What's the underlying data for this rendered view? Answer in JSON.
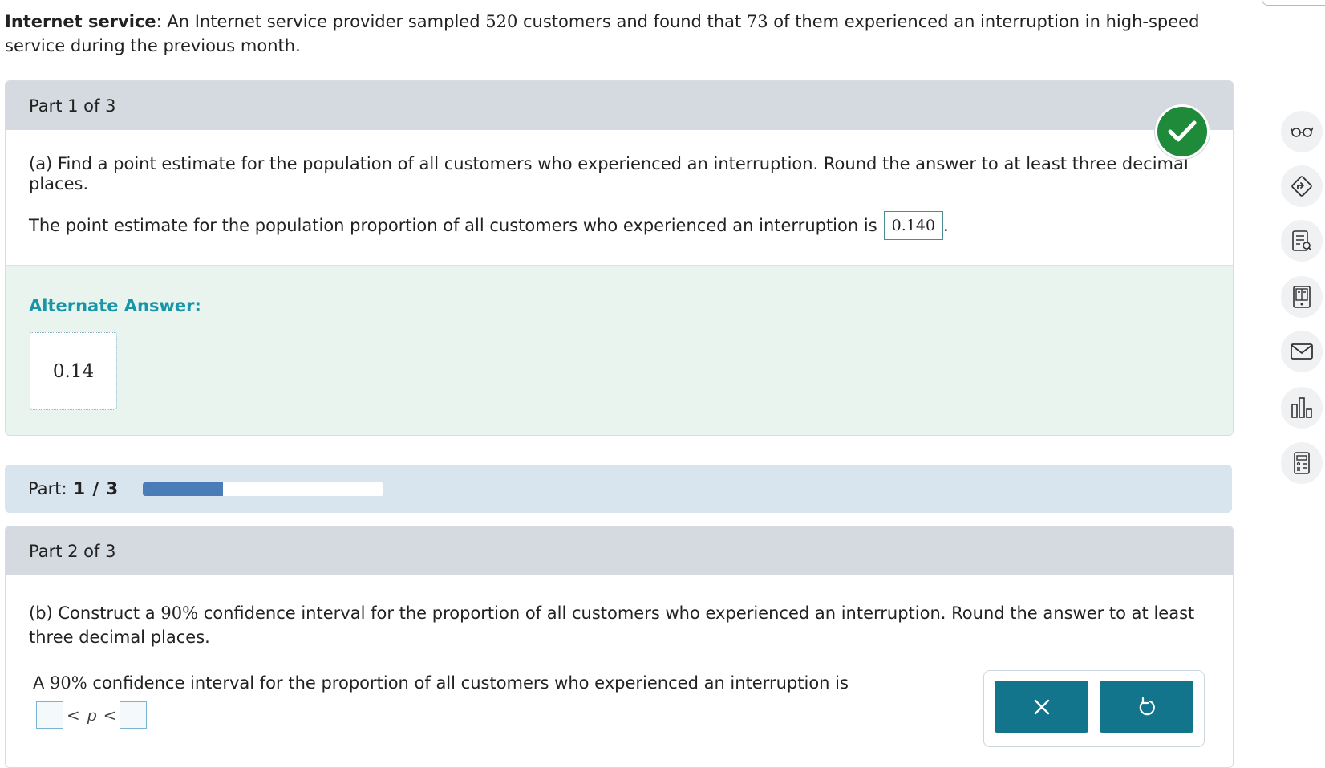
{
  "intro": {
    "title": "Internet service",
    "text_a": ": An Internet service provider sampled ",
    "n": "520",
    "text_b": " customers and found that ",
    "x": "73",
    "text_c": " of them experienced an interruption in high-speed service during the previous month."
  },
  "part1": {
    "header": "Part 1 of 3",
    "question": "(a) Find a point estimate for the population of all customers who experienced an interruption. Round the answer to at least three decimal places.",
    "statement": "The point estimate for the population proportion of all customers who experienced an interruption is",
    "answer": "0.140",
    "period": ".",
    "alternate_label": "Alternate Answer:",
    "alternate_value": "0.14",
    "status_icon": "check-icon",
    "status_color": "#1f8a3a"
  },
  "progress": {
    "label": "Part:",
    "value": "1 / 3",
    "fraction": 0.333,
    "fill_color": "#4a7db8"
  },
  "part2": {
    "header": "Part 2 of 3",
    "question_a": "(b) Construct a ",
    "confidence": "90%",
    "question_b": " confidence interval for the proportion of all customers who experienced an interruption. Round the answer to at least three decimal places.",
    "statement_a": "A ",
    "statement_conf": "90%",
    "statement_b": " confidence interval for the proportion of all customers who experienced an interruption is",
    "lt1": "<",
    "var": "p",
    "lt2": "<",
    "lower_value": "",
    "upper_value": ""
  },
  "actions": {
    "clear_icon": "x-icon",
    "undo_icon": "undo-icon",
    "button_color": "#13758b"
  },
  "sidebar": {
    "items": [
      "glasses-icon",
      "directions-icon",
      "notes-icon",
      "ebook-icon",
      "mail-icon",
      "stats-icon",
      "calculator-icon"
    ]
  }
}
